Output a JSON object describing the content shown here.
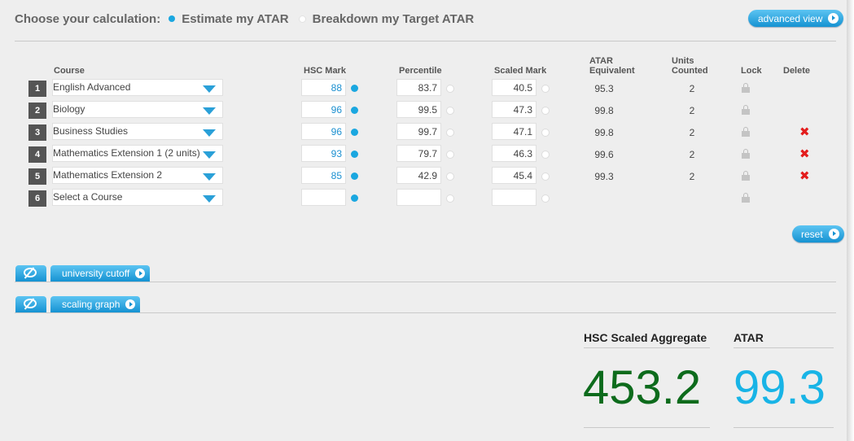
{
  "header": {
    "label": "Choose your calculation:",
    "options": [
      {
        "label": "Estimate my ATAR",
        "selected": true
      },
      {
        "label": "Breakdown my Target ATAR",
        "selected": false
      }
    ],
    "advanced_view_label": "advanced view"
  },
  "table": {
    "columns": {
      "course": "Course",
      "hsc_mark": "HSC Mark",
      "percentile": "Percentile",
      "scaled_mark": "Scaled Mark",
      "atar_equiv_1": "ATAR",
      "atar_equiv_2": "Equivalent",
      "units_1": "Units",
      "units_2": "Counted",
      "lock": "Lock",
      "delete": "Delete"
    },
    "rows": [
      {
        "num": "1",
        "course": "English Advanced",
        "hsc": "88",
        "percentile": "83.7",
        "scaled": "40.5",
        "atar": "95.3",
        "units": "2",
        "delete": false
      },
      {
        "num": "2",
        "course": "Biology",
        "hsc": "96",
        "percentile": "99.5",
        "scaled": "47.3",
        "atar": "99.8",
        "units": "2",
        "delete": false
      },
      {
        "num": "3",
        "course": "Business Studies",
        "hsc": "96",
        "percentile": "99.7",
        "scaled": "47.1",
        "atar": "99.8",
        "units": "2",
        "delete": true
      },
      {
        "num": "4",
        "course": "Mathematics Extension 1 (2 units)",
        "hsc": "93",
        "percentile": "79.7",
        "scaled": "46.3",
        "atar": "99.6",
        "units": "2",
        "delete": true
      },
      {
        "num": "5",
        "course": "Mathematics Extension 2",
        "hsc": "85",
        "percentile": "42.9",
        "scaled": "45.4",
        "atar": "99.3",
        "units": "2",
        "delete": true
      },
      {
        "num": "6",
        "course": "Select a Course",
        "hsc": "",
        "percentile": "",
        "scaled": "",
        "atar": "",
        "units": "",
        "delete": false
      }
    ]
  },
  "reset_label": "reset",
  "sections": [
    {
      "label": "university cutoff"
    },
    {
      "label": "scaling graph"
    }
  ],
  "results": {
    "aggregate_label": "HSC Scaled Aggregate",
    "aggregate_value": "453.2",
    "aggregate_color": "#0d6b1c",
    "atar_label": "ATAR",
    "atar_value": "99.3",
    "atar_color": "#18b4e6"
  },
  "icons": {
    "delete": "✖",
    "selected_radio": "#1aa7e0"
  }
}
